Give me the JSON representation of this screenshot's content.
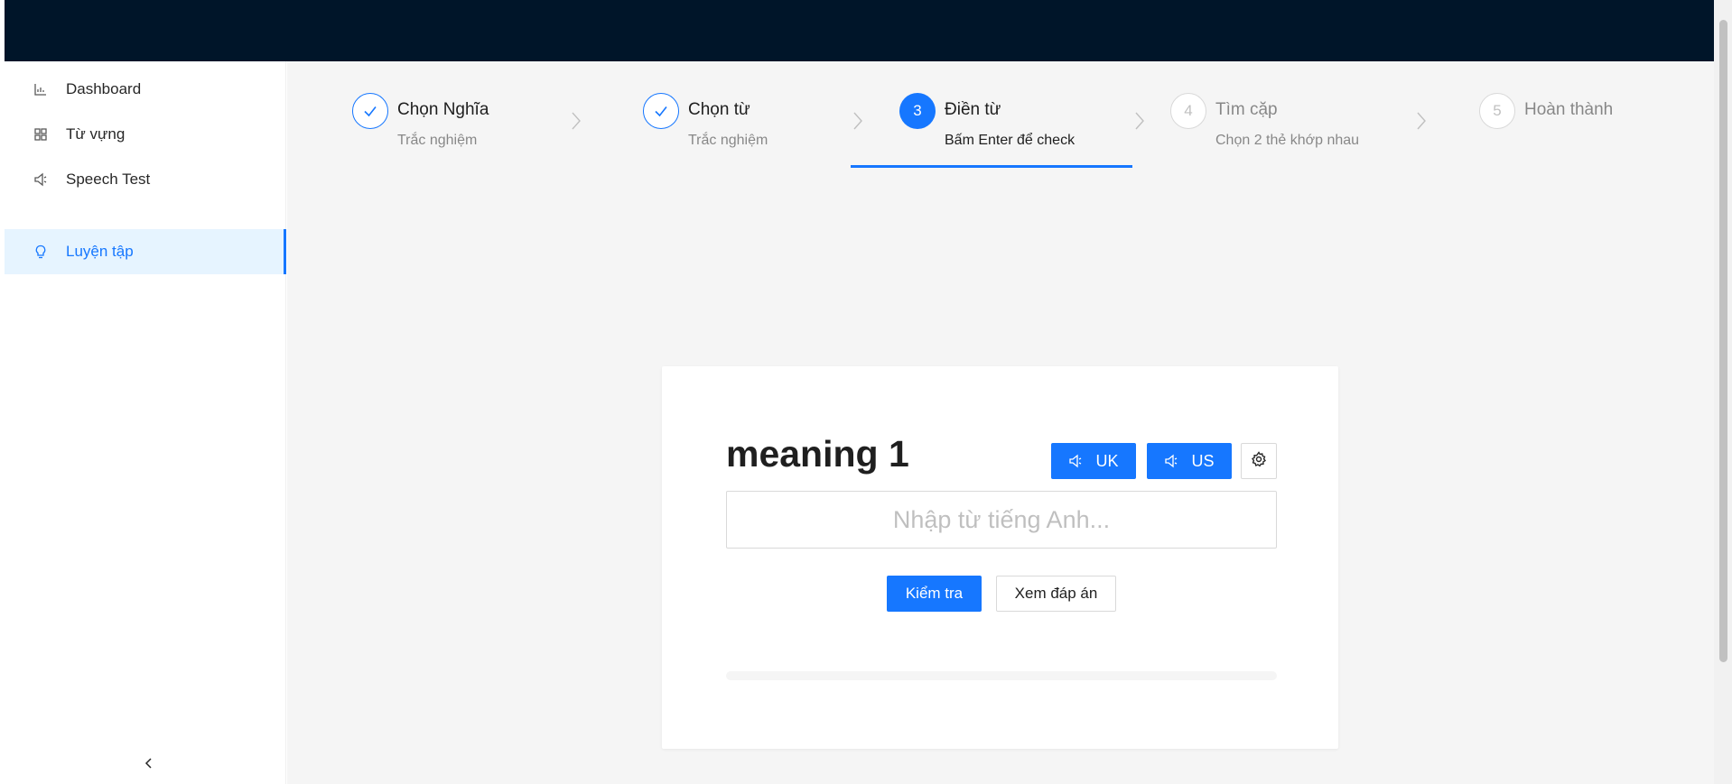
{
  "sidebar": {
    "items": [
      {
        "label": "Dashboard",
        "icon": "bar-chart-icon",
        "active": false
      },
      {
        "label": "Từ vựng",
        "icon": "grid-icon",
        "active": false
      },
      {
        "label": "Speech Test",
        "icon": "sound-icon",
        "active": false
      },
      {
        "label": "Luyện tập",
        "icon": "bulb-icon",
        "active": true
      }
    ],
    "collapse_icon": "chevron-left-icon"
  },
  "steps": [
    {
      "number": "1",
      "title": "Chọn Nghĩa",
      "description": "Trắc nghiệm",
      "status": "finish"
    },
    {
      "number": "2",
      "title": "Chọn từ",
      "description": "Trắc nghiệm",
      "status": "finish"
    },
    {
      "number": "3",
      "title": "Điền từ",
      "description": "Bấm Enter để check",
      "status": "process"
    },
    {
      "number": "4",
      "title": "Tìm cặp",
      "description": "Chọn 2 thẻ khớp nhau",
      "status": "wait"
    },
    {
      "number": "5",
      "title": "Hoàn thành",
      "description": "",
      "status": "wait"
    }
  ],
  "card": {
    "word": "meaning 1",
    "uk_label": "UK",
    "us_label": "US",
    "settings_icon": "gear-icon",
    "input_placeholder": "Nhập từ tiếng Anh...",
    "input_value": "",
    "check_label": "Kiểm tra",
    "show_answer_label": "Xem đáp án",
    "progress": 0
  },
  "colors": {
    "header": "#001529",
    "primary": "#1677ff",
    "content_bg": "#f5f5f5",
    "active_menu_bg": "#e6f4ff"
  }
}
